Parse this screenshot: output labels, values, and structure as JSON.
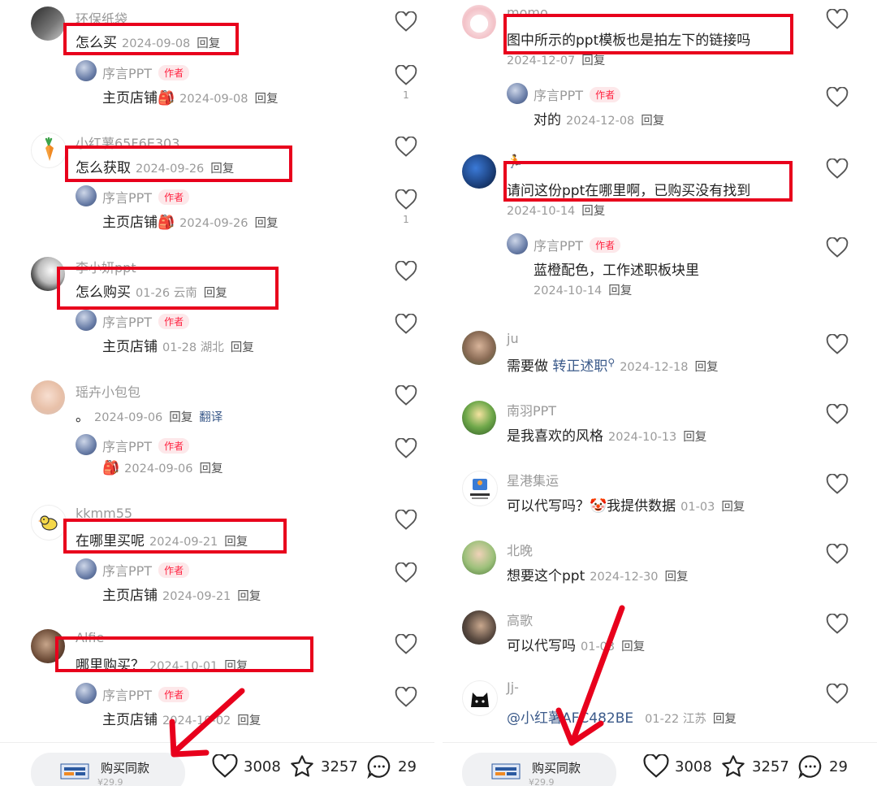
{
  "left": {
    "c1": {
      "user": "环保纸袋",
      "text": "怎么买",
      "date": "2024-09-08",
      "reply": "回复"
    },
    "r1": {
      "user": "序言PPT",
      "badge": "作者",
      "text": "主页店铺🎒",
      "date": "2024-09-08",
      "reply": "回复",
      "likes": "1"
    },
    "c2": {
      "user": "小红薯65F6E303",
      "text": "怎么获取",
      "date": "2024-09-26",
      "reply": "回复"
    },
    "r2": {
      "user": "序言PPT",
      "badge": "作者",
      "text": "主页店铺🎒",
      "date": "2024-09-26",
      "reply": "回复",
      "likes": "1"
    },
    "c3": {
      "user": "李小妍ppt",
      "text": "怎么购买",
      "date": "01-26 云南",
      "reply": "回复"
    },
    "r3": {
      "user": "序言PPT",
      "badge": "作者",
      "text": "主页店铺",
      "date": "01-28 湖北",
      "reply": "回复"
    },
    "c4": {
      "user": "瑶卉小包包",
      "text": "。",
      "date": "2024-09-06",
      "reply": "回复",
      "translate": "翻译"
    },
    "r4": {
      "user": "序言PPT",
      "badge": "作者",
      "text": "🎒",
      "date": "2024-09-06",
      "reply": "回复"
    },
    "c5": {
      "user": "kkmm55",
      "text": "在哪里买呢",
      "date": "2024-09-21",
      "reply": "回复"
    },
    "r5": {
      "user": "序言PPT",
      "badge": "作者",
      "text": "主页店铺",
      "date": "2024-09-21",
      "reply": "回复"
    },
    "c6": {
      "user": "Alfie",
      "text": "哪里购买？",
      "date": "2024-10-01",
      "reply": "回复"
    },
    "r6": {
      "user": "序言PPT",
      "badge": "作者",
      "text": "主页店铺",
      "date": "2024-10-02",
      "reply": "回复"
    },
    "bar": {
      "buy_label": "购买同款",
      "buy_price": "¥29.9",
      "likes": "3008",
      "stars": "3257",
      "comments": "29"
    }
  },
  "right": {
    "c1": {
      "user": "momo",
      "text": "图中所示的ppt模板也是拍左下的链接吗",
      "date": "2024-12-07",
      "reply": "回复"
    },
    "r1": {
      "user": "序言PPT",
      "badge": "作者",
      "text": "对的",
      "date": "2024-12-08",
      "reply": "回复"
    },
    "c2": {
      "user": "🏃",
      "text": "请问这份ppt在哪里啊，已购买没有找到",
      "date": "2024-10-14",
      "reply": "回复"
    },
    "r2": {
      "user": "序言PPT",
      "badge": "作者",
      "text": "蓝橙配色，工作述职板块里",
      "date": "2024-10-14",
      "reply": "回复"
    },
    "c3": {
      "user": "ju",
      "text": "需要做",
      "link": "转正述职",
      "date": "2024-12-18",
      "reply": "回复"
    },
    "c4": {
      "user": "南羽PPT",
      "text": "是我喜欢的风格",
      "date": "2024-10-13",
      "reply": "回复"
    },
    "c5": {
      "user": "星港集运",
      "text": "可以代写吗？🤡我提供数据",
      "date": "01-03",
      "reply": "回复"
    },
    "c6": {
      "user": "北晚",
      "text": "想要这个ppt",
      "date": "2024-12-30",
      "reply": "回复"
    },
    "c7": {
      "user": "高歌",
      "text": "可以代写吗",
      "date": "01-03",
      "reply": "回复"
    },
    "c8": {
      "user": "Jj-",
      "text": "@小红薯AFC482BE",
      "date": "01-22 江苏",
      "reply": "回复"
    },
    "bar": {
      "buy_label": "购买同款",
      "buy_price": "¥29.9",
      "likes": "3008",
      "stars": "3257",
      "comments": "29"
    }
  },
  "colors": {
    "box": "#e8001c",
    "badge_text": "#ff2442",
    "badge_bg": "#fde8ea",
    "link": "#3b5a8a"
  },
  "icons": {
    "like": "heart-icon",
    "collect": "star-icon",
    "comment": "comment-bubble-icon",
    "annotation": "red-arrow"
  }
}
